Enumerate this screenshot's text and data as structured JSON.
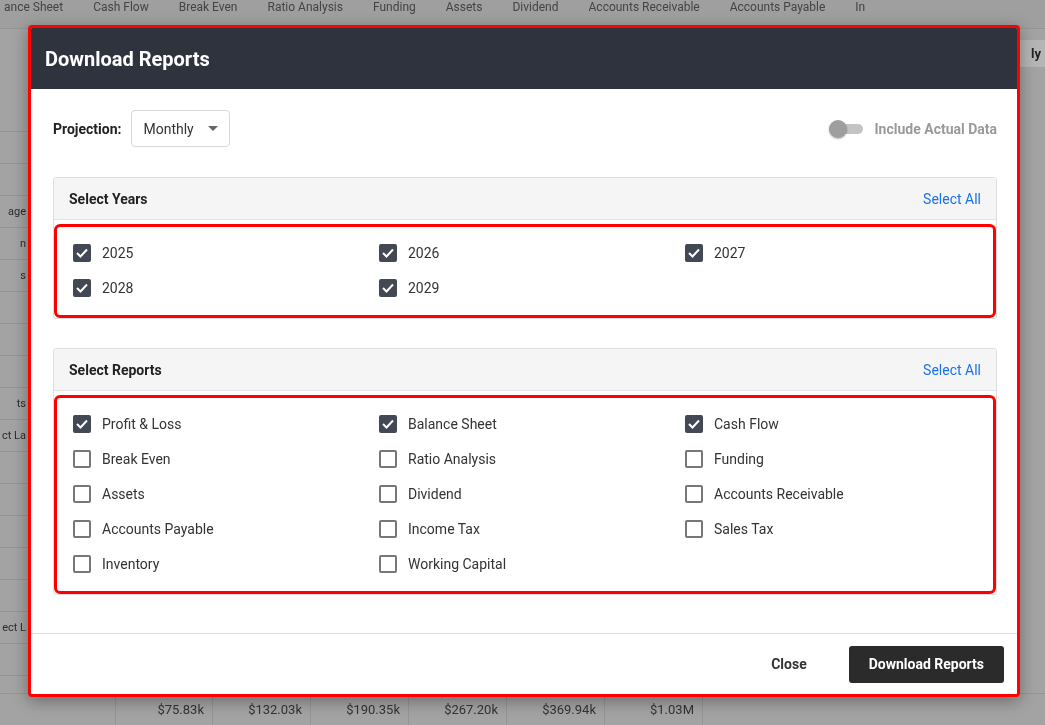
{
  "background": {
    "tabs": [
      "ance Sheet",
      "Cash Flow",
      "Break Even",
      "Ratio Analysis",
      "Funding",
      "Assets",
      "Dividend",
      "Accounts Receivable",
      "Accounts Payable",
      "In"
    ],
    "side_button": "ly",
    "side_rows": [
      {},
      {},
      {},
      {
        "label": "age"
      },
      {
        "label": "n"
      },
      {
        "label": "s"
      },
      {},
      {},
      {},
      {
        "label": "ts"
      },
      {
        "label": "ct La"
      },
      {},
      {},
      {},
      {},
      {},
      {
        "label": "ect L"
      },
      {}
    ],
    "total_row": [
      "$75.83k",
      "$132.03k",
      "$190.35k",
      "$267.20k",
      "$369.94k",
      "$1.03M"
    ]
  },
  "dialog": {
    "title": "Download Reports",
    "highlighted": true,
    "projection": {
      "label": "Projection:",
      "value": "Monthly"
    },
    "include_actual": {
      "label": "Include Actual Data",
      "on": false
    },
    "sections": [
      {
        "title": "Select Years",
        "action": "Select All",
        "highlighted": true,
        "items": [
          {
            "label": "2025",
            "checked": true
          },
          {
            "label": "2026",
            "checked": true
          },
          {
            "label": "2027",
            "checked": true
          },
          {
            "label": "2028",
            "checked": true
          },
          {
            "label": "2029",
            "checked": true
          }
        ]
      },
      {
        "title": "Select Reports",
        "action": "Select All",
        "highlighted": true,
        "items": [
          {
            "label": "Profit & Loss",
            "checked": true
          },
          {
            "label": "Balance Sheet",
            "checked": true
          },
          {
            "label": "Cash Flow",
            "checked": true
          },
          {
            "label": "Break Even",
            "checked": false
          },
          {
            "label": "Ratio Analysis",
            "checked": false
          },
          {
            "label": "Funding",
            "checked": false
          },
          {
            "label": "Assets",
            "checked": false
          },
          {
            "label": "Dividend",
            "checked": false
          },
          {
            "label": "Accounts Receivable",
            "checked": false
          },
          {
            "label": "Accounts Payable",
            "checked": false
          },
          {
            "label": "Income Tax",
            "checked": false
          },
          {
            "label": "Sales Tax",
            "checked": false
          },
          {
            "label": "Inventory",
            "checked": false
          },
          {
            "label": "Working Capital",
            "checked": false
          }
        ]
      }
    ],
    "buttons": [
      {
        "label": "Close",
        "kind": "text"
      },
      {
        "label": "Download Reports",
        "kind": "primary"
      }
    ]
  }
}
